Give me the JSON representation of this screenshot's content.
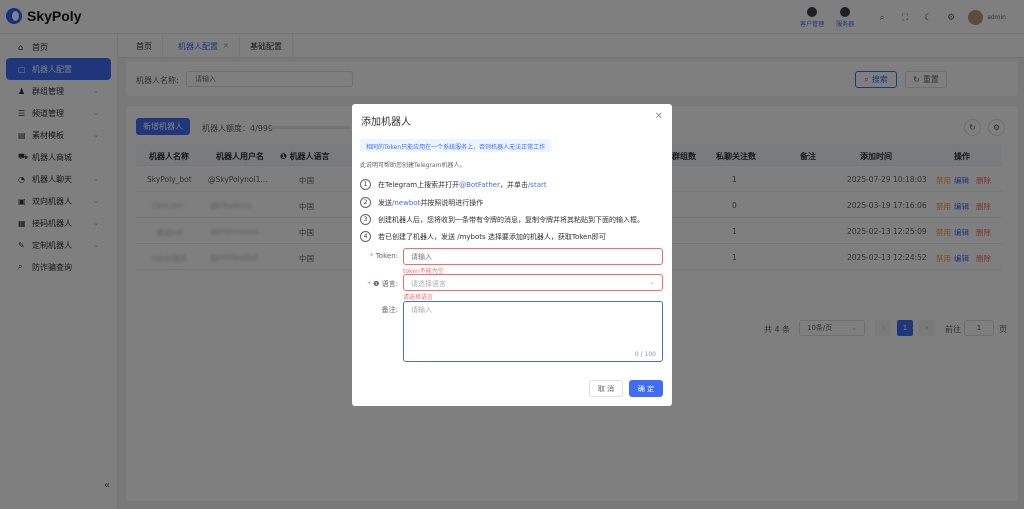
{
  "app": {
    "name": "SkyPoly"
  },
  "topbar": {
    "badges": [
      {
        "label": "客户管理"
      },
      {
        "label": "服务器"
      }
    ],
    "username": "admin"
  },
  "sidebar": {
    "items": [
      {
        "label": "首页",
        "icon": "home-icon",
        "expandable": false
      },
      {
        "label": "机器人配置",
        "icon": "robot-icon",
        "expandable": false,
        "active": true
      },
      {
        "label": "群组管理",
        "icon": "group-icon",
        "expandable": true
      },
      {
        "label": "频道管理",
        "icon": "channel-icon",
        "expandable": true
      },
      {
        "label": "素材模板",
        "icon": "template-icon",
        "expandable": true
      },
      {
        "label": "机器人商城",
        "icon": "cart-icon",
        "expandable": false
      },
      {
        "label": "机器人聊天",
        "icon": "chat-icon",
        "expandable": true
      },
      {
        "label": "双向机器人",
        "icon": "two-way-icon",
        "expandable": true
      },
      {
        "label": "接码机器人",
        "icon": "sms-icon",
        "expandable": true
      },
      {
        "label": "定制机器人",
        "icon": "custom-icon",
        "expandable": true
      },
      {
        "label": "防诈骗查询",
        "icon": "search-icon",
        "expandable": false
      }
    ],
    "collapse": "«"
  },
  "tabs": [
    {
      "label": "首页",
      "active": false
    },
    {
      "label": "机器人配置",
      "active": true
    },
    {
      "label": "基础配置",
      "active": false
    }
  ],
  "search": {
    "label": "机器人名称:",
    "placeholder": "请输入",
    "search_btn": "搜索",
    "reset_btn": "重置"
  },
  "table": {
    "add_button": "新增机器人",
    "quota_label": "机器人额度：4/999",
    "columns": [
      "机器人名称",
      "机器人用户名",
      "机器人语言",
      "加入群组数",
      "私聊关注数",
      "备注",
      "添加时间",
      "操作"
    ],
    "rows": [
      {
        "name": "SkyPoly_bot",
        "username": "@SkyPolynoi1...",
        "language": "中国",
        "groups": "",
        "followers": "1",
        "remark": "",
        "time": "2025-07-29 10:18:03"
      },
      {
        "name": "Cscs.xxt",
        "username": "@Cfxxbcxx",
        "language": "中国",
        "groups": "",
        "followers": "0",
        "remark": "",
        "time": "2025-03-19 17:16:06"
      },
      {
        "name": "测试bot",
        "username": "@shenxxxxx...",
        "language": "中国",
        "groups": "",
        "followers": "1",
        "remark": "",
        "time": "2025-02-13 12:25:09"
      },
      {
        "name": "Inbot测试",
        "username": "@infotestbot",
        "language": "中国",
        "groups": "",
        "followers": "1",
        "remark": "",
        "time": "2025-02-13 12:24:52"
      }
    ],
    "actions": {
      "disable": "禁用",
      "edit": "编辑",
      "delete": "删除"
    }
  },
  "pagination": {
    "total": "共 4 条",
    "page_size": "10条/页",
    "current": "1",
    "goto_label": "前往",
    "goto_value": "1",
    "page_unit": "页"
  },
  "dialog": {
    "title": "添加机器人",
    "alert": "相同的Token只能应用在一个系统服务上，否则机器人无法正常工作",
    "intro": "此说明可帮助您创建Telegram机器人。",
    "steps": [
      {
        "num": "1",
        "pre": "在Telegram上搜索并打开 ",
        "link": "@BotFather",
        "mid": "，并单击",
        "link2": "/start",
        "post": ""
      },
      {
        "num": "2",
        "pre": "发送 ",
        "link": "/newbot",
        "mid": "并按照说明进行操作",
        "link2": "",
        "post": ""
      },
      {
        "num": "3",
        "pre": "创建机器人后，您将收到一条带有令牌的消息，复制令牌并将其粘贴到下面的输入框。",
        "link": "",
        "mid": "",
        "link2": "",
        "post": ""
      },
      {
        "num": "4",
        "pre": "若已创建了机器人，发送 /mybots 选择要添加的机器人，获取Token即可",
        "link": "",
        "mid": "",
        "link2": "",
        "post": ""
      }
    ],
    "token": {
      "label": "Token:",
      "placeholder": "请输入",
      "error": "token不能为空"
    },
    "language": {
      "label": "语言:",
      "placeholder": "请选择语言",
      "error": "请选择语言"
    },
    "remark": {
      "label": "备注:",
      "placeholder": "请输入",
      "count": "0 / 100"
    },
    "cancel": "取 消",
    "confirm": "确 定"
  }
}
